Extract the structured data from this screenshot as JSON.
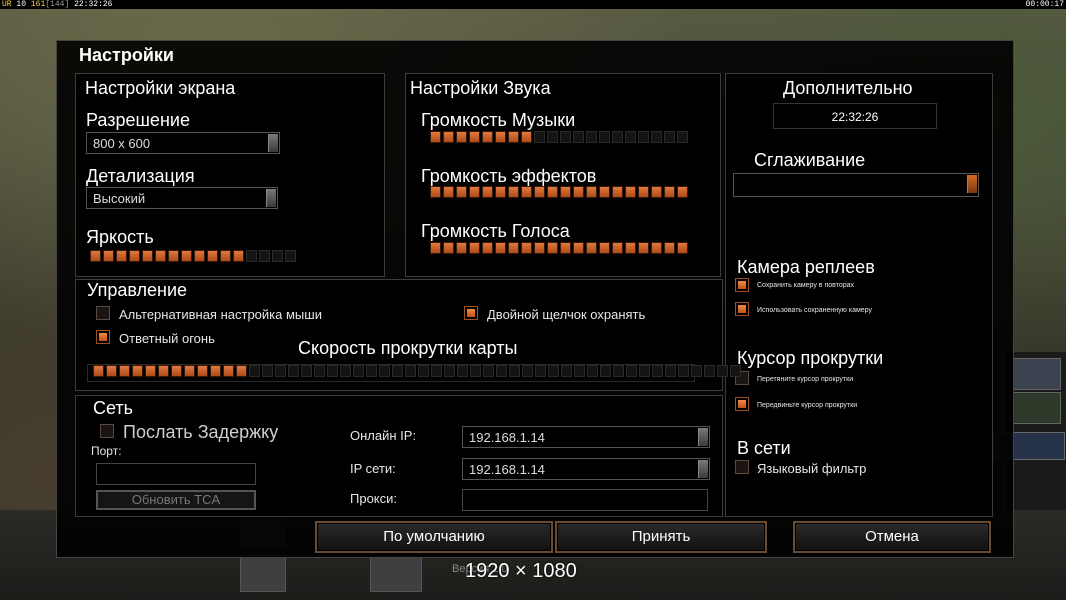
{
  "hud": {
    "left_prefix": "UR",
    "left_a": "10",
    "left_b": "161",
    "left_c": "[144]",
    "left_time": "22:32:26",
    "right_time": "00:00:17"
  },
  "dialog": {
    "title": "Настройки"
  },
  "screen": {
    "title": "Настройки экрана",
    "resolution_label": "Разрешение",
    "resolution_value": "800 x 600",
    "detail_label": "Детализация",
    "detail_value": "Высокий",
    "brightness_label": "Яркость",
    "brightness": {
      "level": 12,
      "total": 16
    }
  },
  "sound": {
    "title": "Настройки Звука",
    "music_label": "Громкость Музыки",
    "music": {
      "level": 8,
      "total": 20
    },
    "effects_label": "Громкость эффектов",
    "effects": {
      "level": 20,
      "total": 20
    },
    "voice_label": "Громкость Голоса",
    "voice": {
      "level": 20,
      "total": 20
    }
  },
  "extra": {
    "title": "Дополнительно",
    "time": "22:32:26",
    "antialias_label": "Сглаживание",
    "antialias_value": "",
    "replay_camera_label": "Камера реплеев",
    "replay_save_camera": {
      "label": "Сохранить камеру в повторах",
      "checked": true
    },
    "replay_use_camera": {
      "label": "Использовать сохраненную камеру",
      "checked": true
    },
    "scroll_cursor_label": "Курсор прокрутки",
    "scroll_drag": {
      "label": "Перетяните курсор прокрутки",
      "checked": false
    },
    "scroll_move": {
      "label": "Передвиньте курсор прокрутки",
      "checked": true
    },
    "online_label": "В сети",
    "lang_filter": {
      "label": "Языковый фильтр",
      "checked": false
    }
  },
  "control": {
    "title": "Управление",
    "alt_mouse": {
      "label": "Альтернативная настройка мыши",
      "checked": false
    },
    "double_click": {
      "label": "Двойной щелчок охранять",
      "checked": true
    },
    "return_fire": {
      "label": "Ответный огонь",
      "checked": true
    },
    "scroll_speed_label": "Скорость прокрутки карты",
    "scroll_speed": {
      "level": 12,
      "total": 50
    }
  },
  "network": {
    "title": "Сеть",
    "send_delay": {
      "label": "Послать Задержку",
      "checked": false
    },
    "port_label": "Порт:",
    "port_value": "",
    "update_button": "Обновить TCA",
    "online_ip_label": "Онлайн IP:",
    "online_ip_value": "192.168.1.14",
    "lan_ip_label": "IP сети:",
    "lan_ip_value": "192.168.1.14",
    "proxy_label": "Прокси:",
    "proxy_value": ""
  },
  "buttons": {
    "defaults": "По умолчанию",
    "accept": "Принять",
    "cancel": "Отмена"
  },
  "overlay": {
    "resolution_text": "1920 × 1080",
    "version_text": "Версия 1.0"
  },
  "colors": {
    "accent": "#d86a20",
    "panel_bg": "#000000",
    "text": "#ffffff"
  }
}
